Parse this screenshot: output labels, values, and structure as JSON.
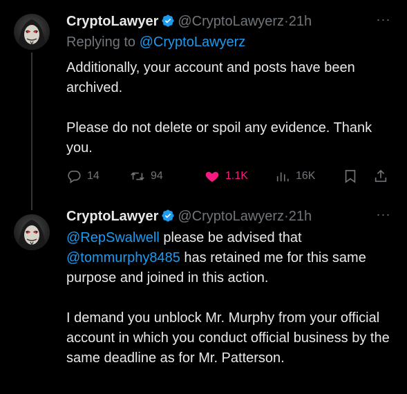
{
  "tweets": [
    {
      "author_name": "CryptoLawyer",
      "handle": "@CryptoLawyerz",
      "separator": "·",
      "time": "21h",
      "more": "···",
      "replying_prefix": "Replying to",
      "replying_to": "@CryptoLawyerz",
      "paragraphs": [
        "Additionally, your account and posts have been archived.",
        "Please do not delete or spoil any evidence. Thank you."
      ],
      "actions": {
        "replies": "14",
        "reposts": "94",
        "likes": "1.1K",
        "views": "16K"
      }
    },
    {
      "author_name": "CryptoLawyer",
      "handle": "@CryptoLawyerz",
      "separator": "·",
      "time": "21h",
      "more": "···",
      "mention_1": "@RepSwalwell",
      "text_1": " please be advised that ",
      "mention_2": "@tommurphy8485",
      "text_2": " has retained me for this same purpose and joined in this action.",
      "paragraph_2": "I demand you unblock Mr. Murphy from your official account in which you conduct official business by the same deadline as for Mr. Patterson."
    }
  ],
  "colors": {
    "background": "#000000",
    "text": "#e7e9ea",
    "muted": "#71767b",
    "link": "#1d9bf0",
    "like": "#f91880",
    "verified": "#1d9bf0"
  }
}
